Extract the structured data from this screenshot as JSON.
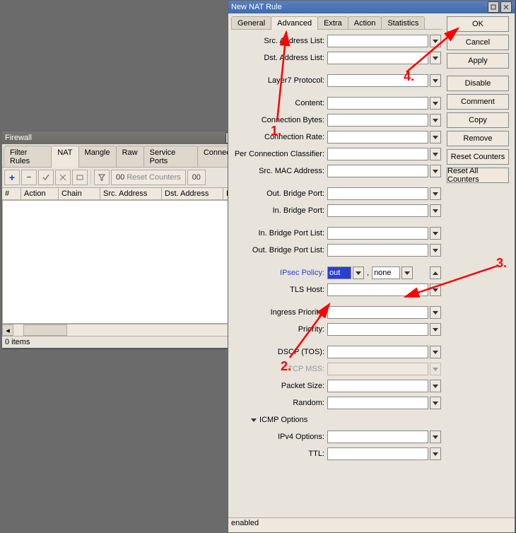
{
  "firewall": {
    "title": "Firewall",
    "tabs": [
      "Filter Rules",
      "NAT",
      "Mangle",
      "Raw",
      "Service Ports",
      "Connections"
    ],
    "active_tab": "NAT",
    "toolbar": {
      "reset_counters": "Reset Counters",
      "reset_all": "00"
    },
    "columns": {
      "num": "#",
      "action": "Action",
      "chain": "Chain",
      "src": "Src. Address",
      "dst": "Dst. Address",
      "proto": "Pro"
    },
    "status": "0 items"
  },
  "nat_rule": {
    "title": "New NAT Rule",
    "tabs": [
      "General",
      "Advanced",
      "Extra",
      "Action",
      "Statistics"
    ],
    "active_tab": "Advanced",
    "buttons": {
      "ok": "OK",
      "cancel": "Cancel",
      "apply": "Apply",
      "disable": "Disable",
      "comment": "Comment",
      "copy": "Copy",
      "remove": "Remove",
      "reset_counters": "Reset Counters",
      "reset_all": "Reset All Counters"
    },
    "fields": {
      "src_addr_list": {
        "label": "Src. Address List:",
        "value": ""
      },
      "dst_addr_list": {
        "label": "Dst. Address List:",
        "value": ""
      },
      "layer7": {
        "label": "Layer7 Protocol:",
        "value": ""
      },
      "content": {
        "label": "Content:",
        "value": ""
      },
      "conn_bytes": {
        "label": "Connection Bytes:",
        "value": ""
      },
      "conn_rate": {
        "label": "Connection Rate:",
        "value": ""
      },
      "pcc": {
        "label": "Per Connection Classifier:",
        "value": ""
      },
      "src_mac": {
        "label": "Src. MAC Address:",
        "value": ""
      },
      "out_bridge": {
        "label": "Out. Bridge Port:",
        "value": ""
      },
      "in_bridge": {
        "label": "In. Bridge Port:",
        "value": ""
      },
      "in_bridge_list": {
        "label": "In. Bridge Port List:",
        "value": ""
      },
      "out_bridge_list": {
        "label": "Out. Bridge Port List:",
        "value": ""
      },
      "ipsec": {
        "label": "IPsec Policy:",
        "dir": "out",
        "sep": ",",
        "policy": "none"
      },
      "tls_host": {
        "label": "TLS Host:",
        "value": ""
      },
      "ingress_prio": {
        "label": "Ingress Priority:",
        "value": ""
      },
      "priority": {
        "label": "Priority:",
        "value": ""
      },
      "dscp": {
        "label": "DSCP (TOS):",
        "value": ""
      },
      "tcp_mss": {
        "label": "TCP MSS:",
        "value": ""
      },
      "packet_size": {
        "label": "Packet Size:",
        "value": ""
      },
      "random": {
        "label": "Random:",
        "value": ""
      },
      "icmp_options": {
        "label": "ICMP Options"
      },
      "ipv4_options": {
        "label": "IPv4 Options:",
        "value": ""
      },
      "ttl": {
        "label": "TTL:",
        "value": ""
      }
    },
    "footer": "enabled"
  },
  "annotations": {
    "1": "1.",
    "2": "2.",
    "3": "3.",
    "4": "4."
  }
}
